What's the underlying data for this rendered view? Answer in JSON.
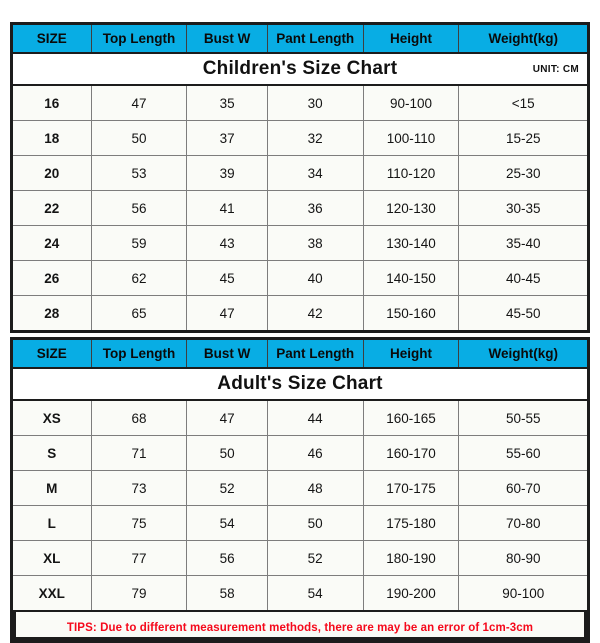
{
  "meta": {
    "unit_label": "UNIT: CM",
    "accent_color": "#08ADE4",
    "tips_color": "#F5091B",
    "border_color": "#1C1C1C",
    "cell_background": "#FAFBF7"
  },
  "children_chart": {
    "title": "Children's Size Chart",
    "unit": "UNIT: CM",
    "columns": [
      "SIZE",
      "Top Length",
      "Bust W",
      "Pant Length",
      "Height",
      "Weight(kg)"
    ],
    "rows": [
      [
        "16",
        "47",
        "35",
        "30",
        "90-100",
        "<15"
      ],
      [
        "18",
        "50",
        "37",
        "32",
        "100-110",
        "15-25"
      ],
      [
        "20",
        "53",
        "39",
        "34",
        "110-120",
        "25-30"
      ],
      [
        "22",
        "56",
        "41",
        "36",
        "120-130",
        "30-35"
      ],
      [
        "24",
        "59",
        "43",
        "38",
        "130-140",
        "35-40"
      ],
      [
        "26",
        "62",
        "45",
        "40",
        "140-150",
        "40-45"
      ],
      [
        "28",
        "65",
        "47",
        "42",
        "150-160",
        "45-50"
      ]
    ]
  },
  "adult_chart": {
    "title": "Adult's Size Chart",
    "columns": [
      "SIZE",
      "Top Length",
      "Bust W",
      "Pant Length",
      "Height",
      "Weight(kg)"
    ],
    "rows": [
      [
        "XS",
        "68",
        "47",
        "44",
        "160-165",
        "50-55"
      ],
      [
        "S",
        "71",
        "50",
        "46",
        "160-170",
        "55-60"
      ],
      [
        "M",
        "73",
        "52",
        "48",
        "170-175",
        "60-70"
      ],
      [
        "L",
        "75",
        "54",
        "50",
        "175-180",
        "70-80"
      ],
      [
        "XL",
        "77",
        "56",
        "52",
        "180-190",
        "80-90"
      ],
      [
        "XXL",
        "79",
        "58",
        "54",
        "190-200",
        "90-100"
      ]
    ]
  },
  "tips": {
    "text": "TIPS: Due to different measurement methods, there are may be an error of 1cm-3cm"
  }
}
